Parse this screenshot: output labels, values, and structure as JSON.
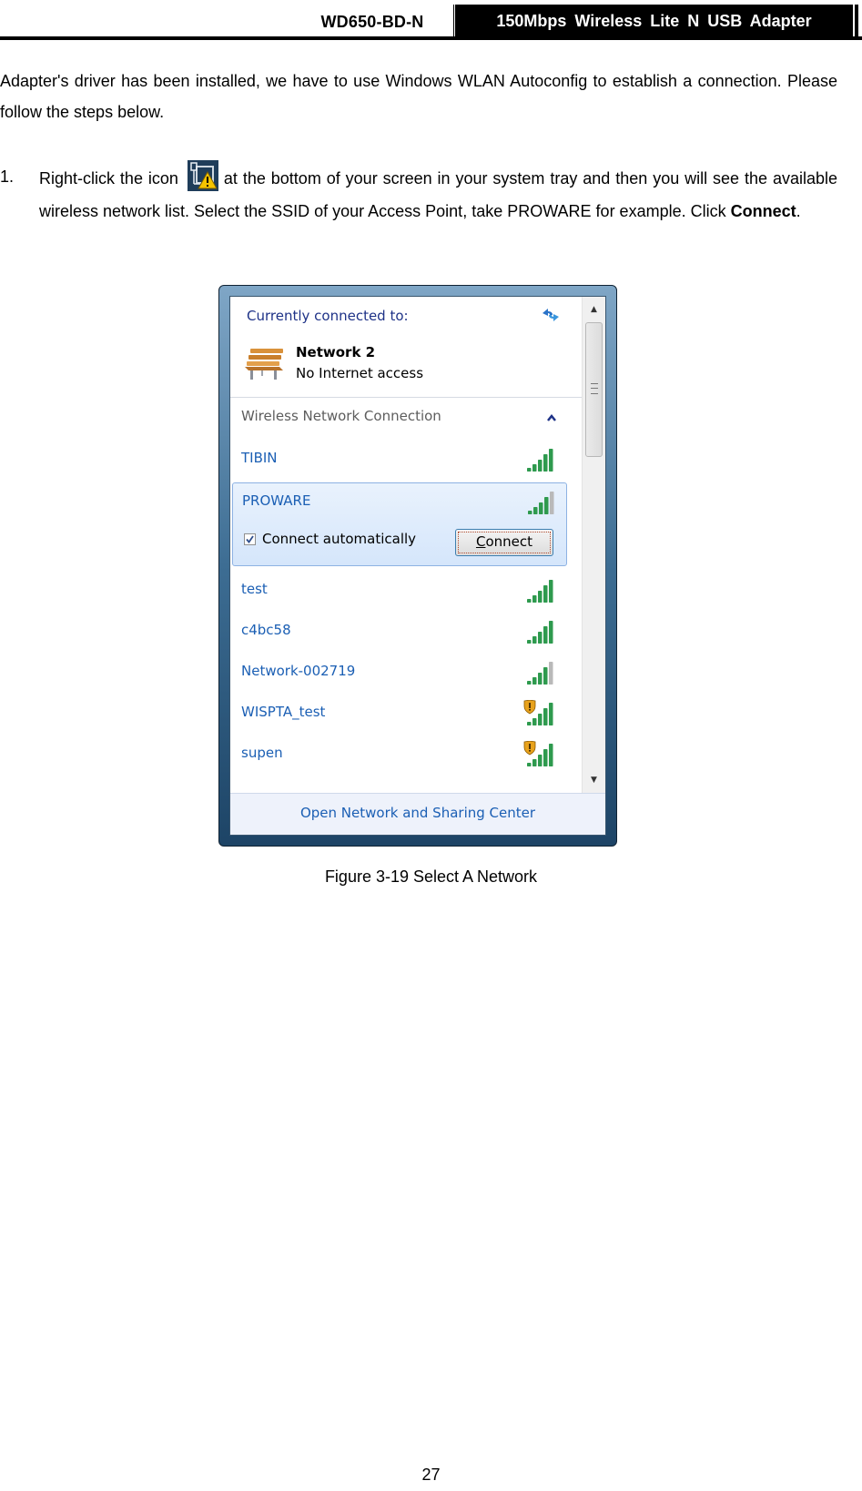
{
  "header": {
    "model": "WD650-BD-N",
    "product": "150Mbps  Wireless  Lite  N  USB  Adapter"
  },
  "intro": {
    "text": "Adapter's driver has been installed, we have to use Windows WLAN Autoconfig to establish a connection. Please follow the steps below."
  },
  "step1": {
    "number": "1.",
    "before_icon": "Right-click the icon",
    "icon": "network-warning-tray-icon",
    "after_icon": "at the bottom of your screen in your system tray and then you will see the available wireless network list. Select the SSID of your Access Point, take PROWARE for example. Click",
    "bold": "Connect",
    "end": "."
  },
  "popup": {
    "connected_label": "Currently connected to:",
    "current_network": {
      "name": "Network  2",
      "status": "No Internet access"
    },
    "section_label": "Wireless Network Connection",
    "networks": [
      {
        "ssid": "TIBIN",
        "signal_bars": 5,
        "secured_warning": false
      },
      {
        "ssid": "PROWARE",
        "signal_bars": 4,
        "secured_warning": false,
        "selected": true
      },
      {
        "ssid": "test",
        "signal_bars": 5,
        "secured_warning": false
      },
      {
        "ssid": "c4bc58",
        "signal_bars": 5,
        "secured_warning": false
      },
      {
        "ssid": "Network-002719",
        "signal_bars": 4,
        "secured_warning": false
      },
      {
        "ssid": "WISPTA_test",
        "signal_bars": 5,
        "secured_warning": true
      },
      {
        "ssid": "supen",
        "signal_bars": 5,
        "secured_warning": true
      }
    ],
    "connect_automatically_label": "Connect automatically",
    "connect_automatically_checked": true,
    "connect_button_accel": "C",
    "connect_button_rest": "onnect",
    "footer_link": "Open Network and Sharing Center",
    "colors": {
      "link": "#1b5fb4",
      "signal_on": "#2e9a4e",
      "signal_off": "#b9b9b9",
      "selection_bg": "#dce9fb"
    }
  },
  "caption": "Figure 3-19 Select A Network",
  "page_number": "27"
}
